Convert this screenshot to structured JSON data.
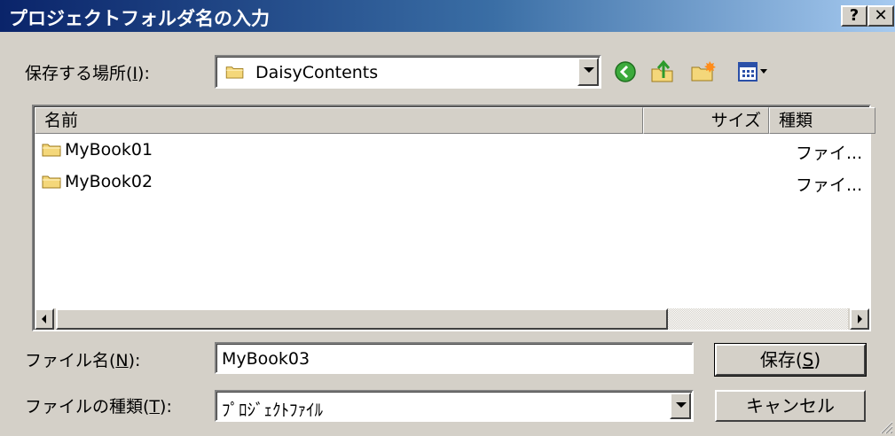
{
  "window": {
    "title": "プロジェクトフォルダ名の入力",
    "help_label": "?",
    "close_label": "✕"
  },
  "location": {
    "label_prefix": "保存する場所(",
    "label_key": "I",
    "label_suffix": "):",
    "value": "DaisyContents"
  },
  "file_list": {
    "columns": [
      {
        "label": "名前"
      },
      {
        "label": "サイズ"
      },
      {
        "label": "種類"
      }
    ],
    "items": [
      {
        "name": "MyBook01",
        "type": "ファイ..."
      },
      {
        "name": "MyBook02",
        "type": "ファイ..."
      }
    ]
  },
  "filename": {
    "label_prefix": "ファイル名(",
    "label_key": "N",
    "label_suffix": "):",
    "value": "MyBook03"
  },
  "filetype": {
    "label_prefix": "ファイルの種類(",
    "label_key": "T",
    "label_suffix": "):",
    "value": "ﾌﾟﾛｼﾞｪｸﾄﾌｧｲﾙ"
  },
  "buttons": {
    "save_prefix": "保存(",
    "save_key": "S",
    "save_suffix": ")",
    "cancel": "キャンセル"
  },
  "colors": {
    "title_start": "#0a246a",
    "title_end": "#a6caf0",
    "dialog_bg": "#d4d0c8",
    "folder_fill": "#f4d77a"
  },
  "icons": [
    "folder-icon",
    "back-icon",
    "up-folder-icon",
    "new-folder-icon",
    "view-menu-icon",
    "help-icon",
    "close-icon"
  ]
}
